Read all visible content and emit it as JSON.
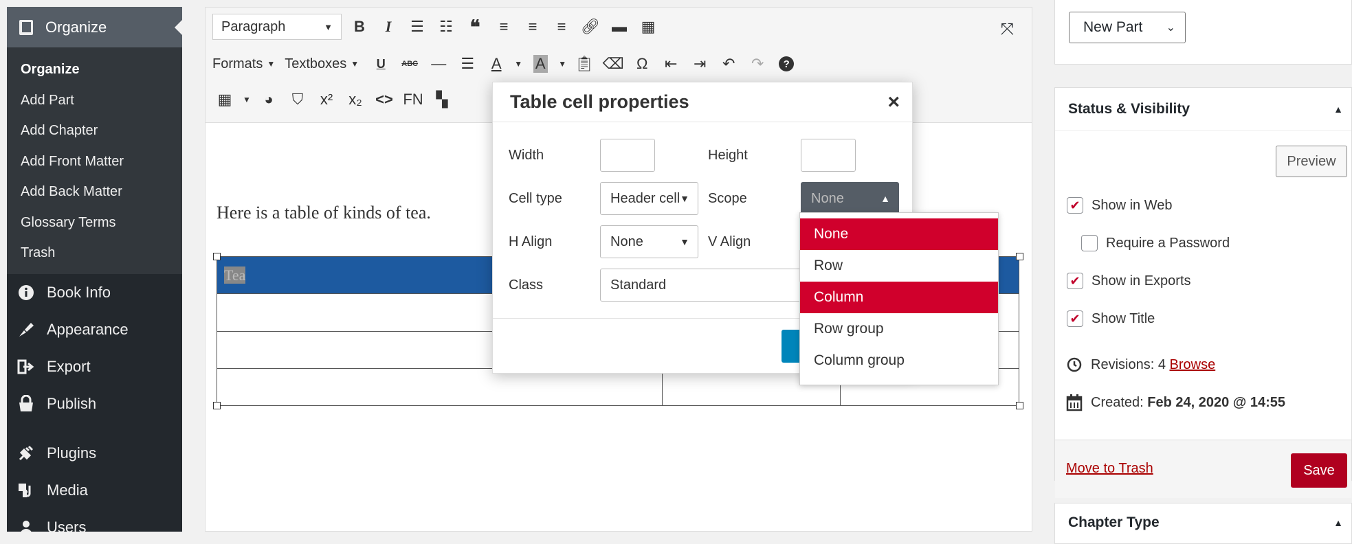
{
  "sidebar": {
    "current_menu": "Organize",
    "submenu": [
      "Organize",
      "Add Part",
      "Add Chapter",
      "Add Front Matter",
      "Add Back Matter",
      "Glossary Terms",
      "Trash"
    ],
    "menu": [
      {
        "label": "Book Info",
        "icon": "info-icon"
      },
      {
        "label": "Appearance",
        "icon": "brush-icon"
      },
      {
        "label": "Export",
        "icon": "export-icon"
      },
      {
        "label": "Publish",
        "icon": "shop-icon"
      },
      {
        "label": "Plugins",
        "icon": "plugin-icon"
      },
      {
        "label": "Media",
        "icon": "media-icon"
      },
      {
        "label": "Users",
        "icon": "users-icon"
      }
    ]
  },
  "toolbar": {
    "block_format": "Paragraph",
    "formats_label": "Formats",
    "textboxes_label": "Textboxes",
    "fn_label": "FN"
  },
  "content": {
    "paragraph": "Here is a table of kinds of tea.",
    "table_header_cell": "Tea"
  },
  "modal": {
    "title": "Table cell properties",
    "close": "×",
    "width_label": "Width",
    "height_label": "Height",
    "width_value": "",
    "height_value": "",
    "cell_type_label": "Cell type",
    "cell_type_value": "Header cell",
    "scope_label": "Scope",
    "scope_value": "None",
    "h_align_label": "H Align",
    "h_align_value": "None",
    "v_align_label": "V Align",
    "class_label": "Class",
    "class_value": "Standard",
    "scope_options": [
      "None",
      "Row",
      "Column",
      "Row group",
      "Column group"
    ]
  },
  "right": {
    "part_select": "New Part",
    "status_title": "Status & Visibility",
    "preview": "Preview",
    "show_in_web": "Show in Web",
    "require_password": "Require a Password",
    "show_in_exports": "Show in Exports",
    "show_title": "Show Title",
    "revisions_label": "Revisions: 4",
    "browse": "Browse",
    "created_label": "Created:",
    "created_value": "Feb 24, 2020 @ 14:55",
    "move_to_trash": "Move to Trash",
    "save": "Save",
    "chapter_type_title": "Chapter Type"
  },
  "colors": {
    "accent_red": "#d0002c",
    "save_red": "#b0001f",
    "table_header_blue": "#1d5aa0",
    "sidebar_dark": "#23282d"
  }
}
